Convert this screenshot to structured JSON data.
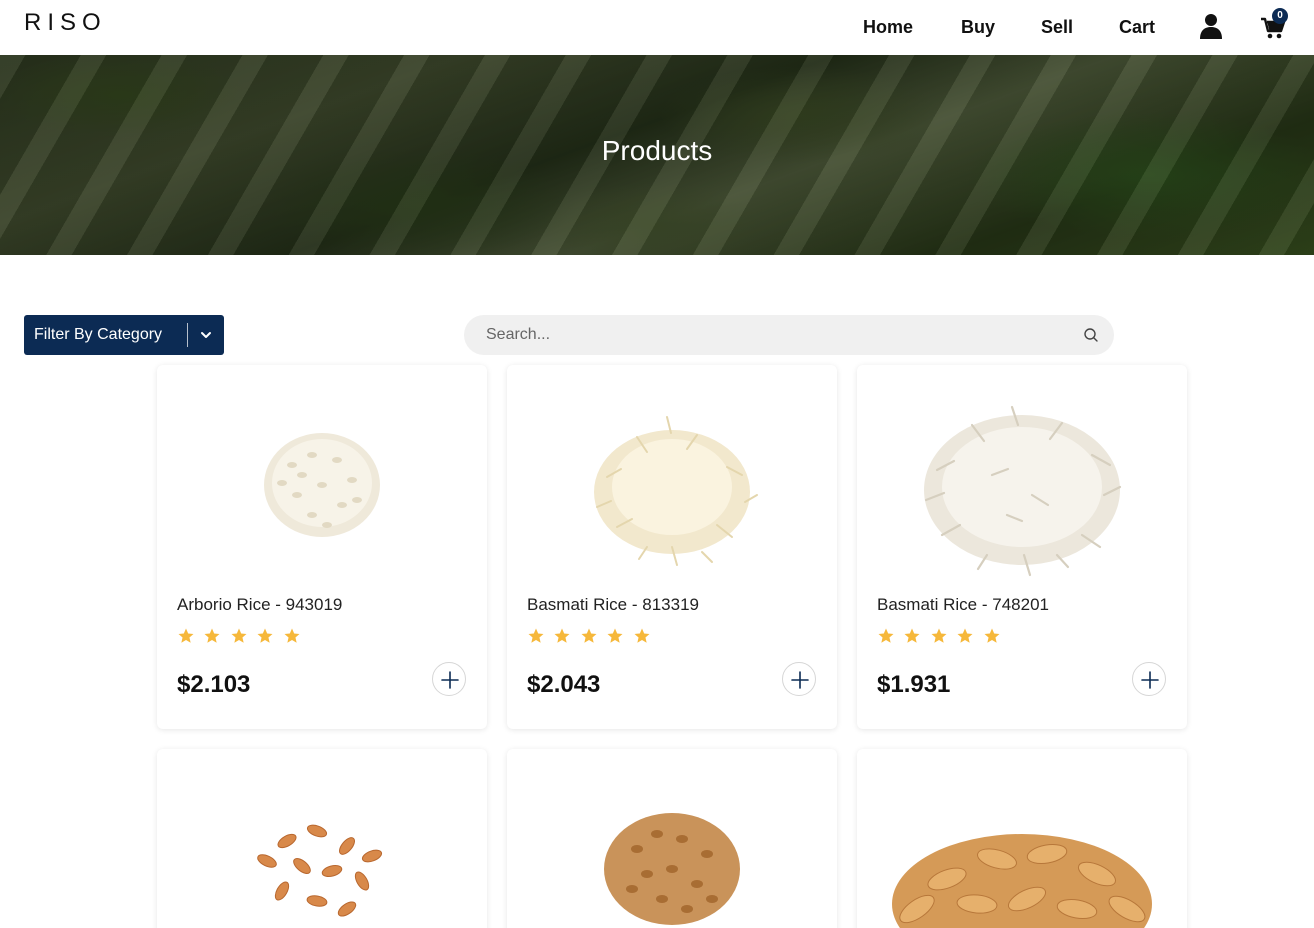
{
  "brand": {
    "logo": "RISO"
  },
  "nav": {
    "home": "Home",
    "buy": "Buy",
    "sell": "Sell",
    "cart": "Cart",
    "cart_count": "0"
  },
  "hero": {
    "title": "Products"
  },
  "filter": {
    "label": "Filter By Category"
  },
  "search": {
    "placeholder": "Search..."
  },
  "colors": {
    "accent": "#0c2b54",
    "star": "#f6b83b"
  },
  "products": [
    {
      "name": "Arborio Rice - 943019",
      "price": "$2.103",
      "rating": 5,
      "icon": "arborio-rice-image"
    },
    {
      "name": "Basmati Rice - 813319",
      "price": "$2.043",
      "rating": 5,
      "icon": "basmati-rice-image"
    },
    {
      "name": "Basmati Rice - 748201",
      "price": "$1.931",
      "rating": 5,
      "icon": "basmati-rice-image"
    },
    {
      "icon": "wheat-grain-image"
    },
    {
      "icon": "wheat-grain-image"
    },
    {
      "icon": "kamut-grain-image"
    }
  ]
}
